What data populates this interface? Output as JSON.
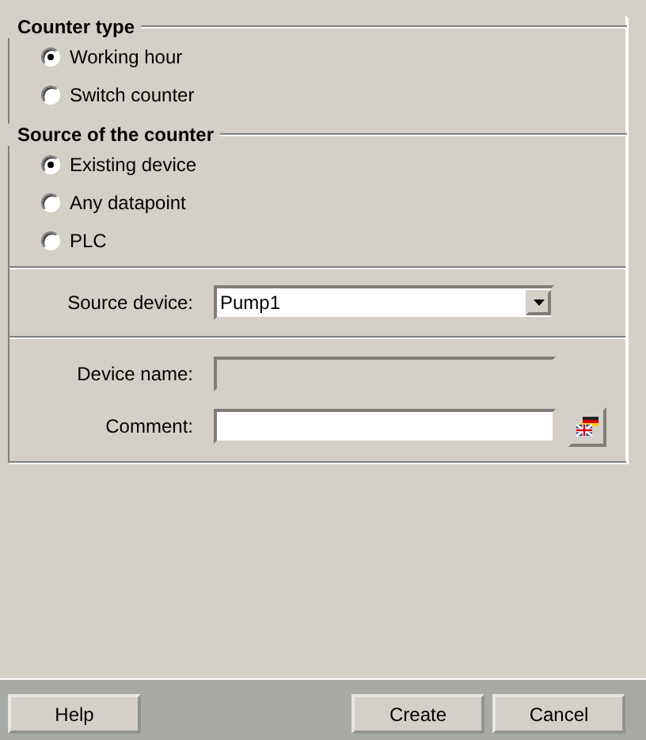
{
  "counter_type": {
    "title": "Counter type",
    "options": [
      {
        "label": "Working hour",
        "selected": true
      },
      {
        "label": "Switch counter",
        "selected": false
      }
    ]
  },
  "source": {
    "title": "Source of the counter",
    "options": [
      {
        "label": "Existing device",
        "selected": true
      },
      {
        "label": "Any datapoint",
        "selected": false
      },
      {
        "label": "PLC",
        "selected": false
      }
    ]
  },
  "source_device": {
    "label": "Source device:",
    "value": "Pump1"
  },
  "device_name": {
    "label": "Device name:",
    "disabled": true
  },
  "comment": {
    "label": "Comment:"
  },
  "buttons": {
    "help": "Help",
    "create": "Create",
    "cancel": "Cancel"
  }
}
